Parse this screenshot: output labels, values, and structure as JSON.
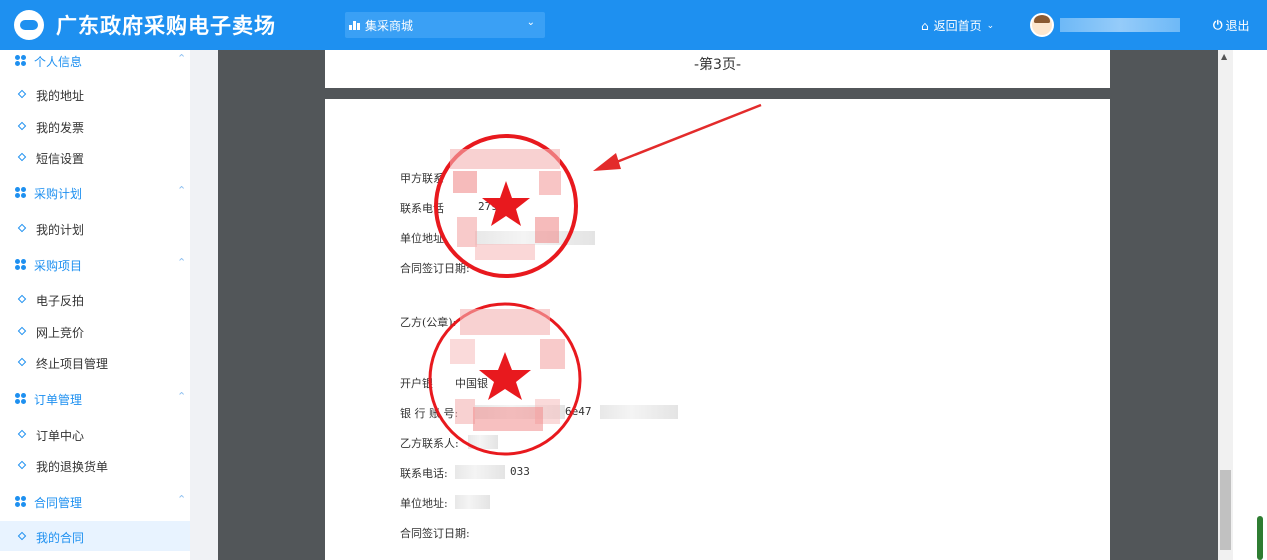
{
  "header": {
    "site_title": "广东政府采购电子卖场",
    "store_select": "集采商城",
    "home_link": "返回首页",
    "logout": "退出"
  },
  "sidebar": {
    "groups": [
      {
        "label": "个人信息",
        "items": [
          "我的地址",
          "我的发票",
          "短信设置"
        ]
      },
      {
        "label": "采购计划",
        "items": [
          "我的计划"
        ]
      },
      {
        "label": "采购项目",
        "items": [
          "电子反拍",
          "网上竞价",
          "终止项目管理"
        ]
      },
      {
        "label": "订单管理",
        "items": [
          "订单中心",
          "我的退换货单"
        ]
      },
      {
        "label": "合同管理",
        "items": [
          "我的合同"
        ]
      }
    ]
  },
  "document": {
    "page_number": "-第3页-",
    "party_a": {
      "contact": "甲方联系",
      "phone_label": "联系电话",
      "phone_partial": "27936",
      "address_label": "单位地址",
      "sign_date": "合同签订日期:"
    },
    "party_b": {
      "seal_label": "乙方(公章):",
      "bank_label": "开户银",
      "bank_name": "中国银",
      "account_label": "银 行 账 号:",
      "account_partial": "6e47",
      "contact_label": "乙方联系人:",
      "phone_label": "联系电话:",
      "phone_partial": "033",
      "address_label": "单位地址:",
      "sign_date": "合同签订日期:"
    }
  },
  "colors": {
    "header_bg": "#1e90f0",
    "seal_red": "#e8191e",
    "arrow_red": "#e32b2b",
    "viewer_bg": "#525659"
  }
}
